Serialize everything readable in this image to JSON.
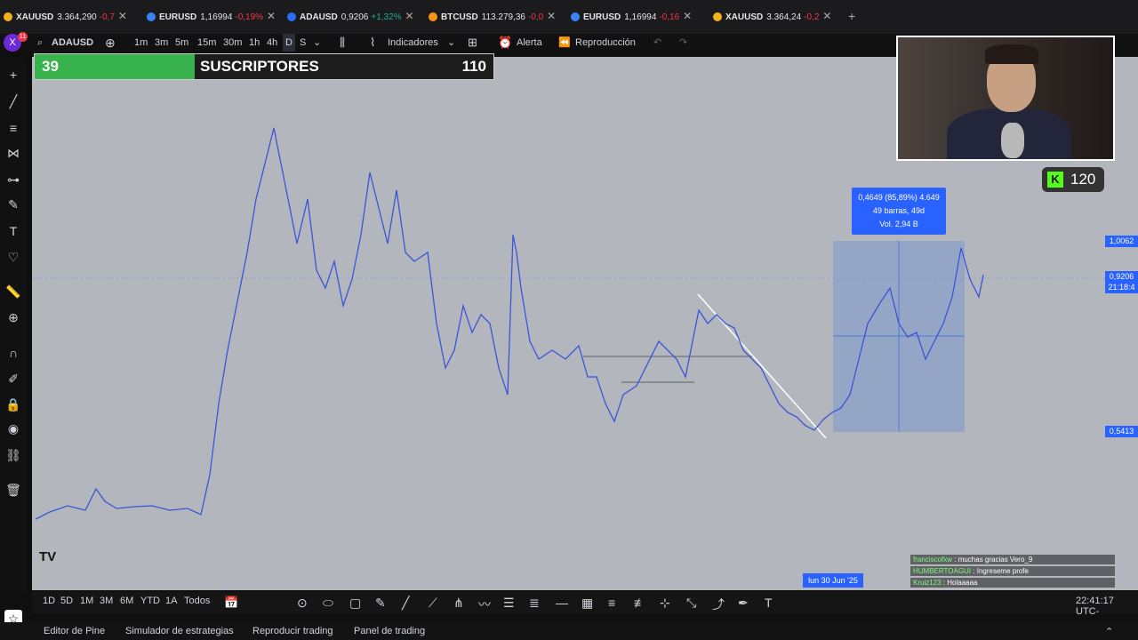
{
  "tabs": [
    {
      "symbol": "XAUUSD",
      "value": "3.364,290",
      "change": "-0,7",
      "color": "#f5b021",
      "up": false
    },
    {
      "symbol": "EURUSD",
      "value": "1,16994",
      "change": "-0,19%",
      "color": "#3b82f6",
      "up": false
    },
    {
      "symbol": "ADAUSD",
      "value": "0,9206",
      "change": "+1,32%",
      "color": "#2b6cf6",
      "up": true
    },
    {
      "symbol": "BTCUSD",
      "value": "113.279,36",
      "change": "-0,0",
      "color": "#f7931a",
      "up": false
    },
    {
      "symbol": "EURUSD",
      "value": "1,16994",
      "change": "-0,16",
      "color": "#3b82f6",
      "up": false
    },
    {
      "symbol": "XAUUSD",
      "value": "3.364,24",
      "change": "-0,2",
      "color": "#f5b021",
      "up": false
    }
  ],
  "toolbar": {
    "symbol": "ADAUSD",
    "intervals": [
      "1m",
      "3m",
      "5m",
      "15m",
      "30m",
      "1h",
      "4h",
      "D",
      "S"
    ],
    "indicators": "Indicadores",
    "alert": "Alerta",
    "replay": "Reproducción",
    "notif_count": "11"
  },
  "overlay": {
    "subs_current": "39",
    "subs_label": "SUSCRIPTORES",
    "subs_goal": "110",
    "kick_count": "120"
  },
  "measure": {
    "line1": "0,4649 (85,89%) 4.649",
    "line2": "49 barras, 49d",
    "line3": "Vol. 2,94 B"
  },
  "price_tags": {
    "top": "1,0062",
    "current": "0,9206",
    "countdown": "21:18:4",
    "bottom": "0,5413"
  },
  "date_box": "lun 30 Jun '25",
  "bottom": {
    "ranges": [
      "1D",
      "5D",
      "1M",
      "3M",
      "6M",
      "YTD",
      "1A",
      "Todos"
    ],
    "clock": "22:41:17 UTC-"
  },
  "footer": {
    "items": [
      "Editor de Pine",
      "Simulador de estrategias",
      "Reproducir trading",
      "Panel de trading"
    ]
  },
  "chat": [
    {
      "user": "franciscofxw",
      "msg": "muchas gracias Vero_9"
    },
    {
      "user": "HUMBERTOAGUI",
      "msg": "Ingreseme profe"
    },
    {
      "user": "Kruiz123",
      "msg": "Holaaaaa"
    }
  ]
}
